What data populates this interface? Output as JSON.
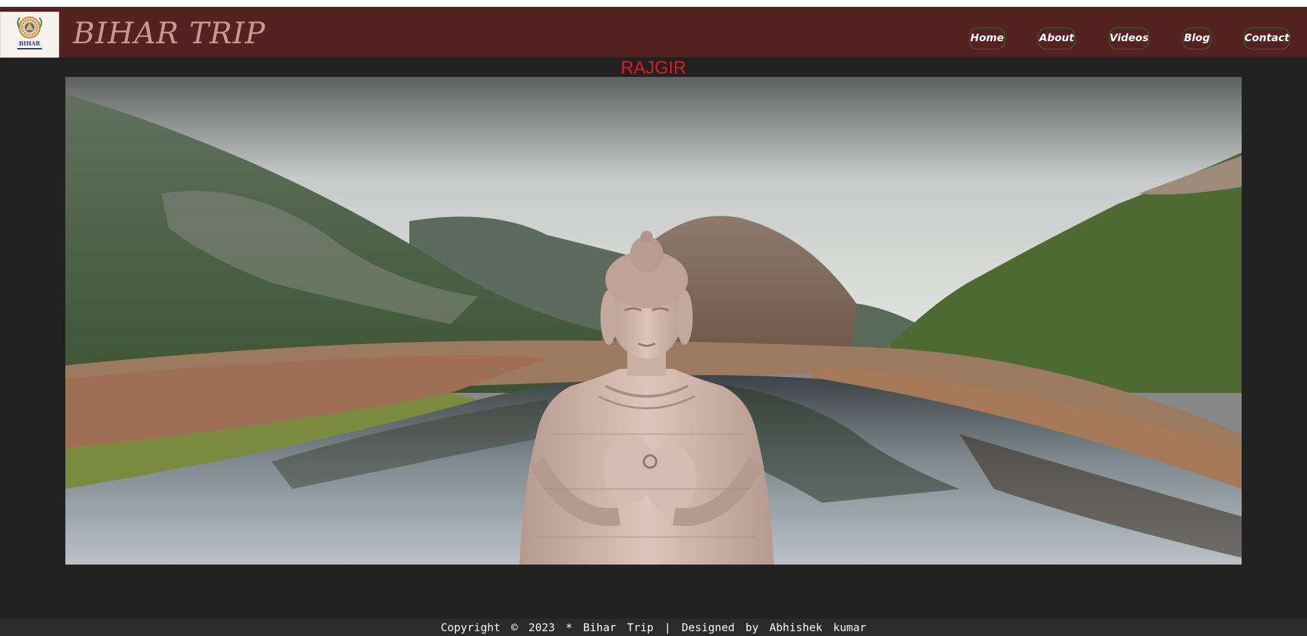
{
  "header": {
    "logo_text": "BIHAR",
    "site_title": "BIHAR TRIP"
  },
  "nav": [
    {
      "label": "Home"
    },
    {
      "label": "About"
    },
    {
      "label": "Videos"
    },
    {
      "label": "Blog"
    },
    {
      "label": "Contact"
    }
  ],
  "main": {
    "heading": "RAJGIR",
    "hero_subject": "buddha-statue-lake-hills"
  },
  "footer": {
    "text": "Copyright © 2023 * Bihar Trip | Designed by Abhishek kumar"
  },
  "colors": {
    "navbar": "#552222",
    "page_background": "#222222",
    "heading": "#e11a1a",
    "nav_border": "#3a6a2c",
    "title": "#c69a93"
  }
}
